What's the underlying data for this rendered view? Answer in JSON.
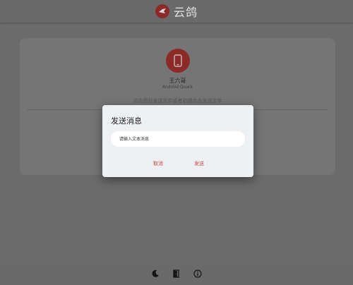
{
  "header": {
    "title": "云鸽",
    "logo_icon": "pigeon-logo-icon"
  },
  "device": {
    "icon": "smartphone-icon",
    "name": "王六哥",
    "subtitle": "Android Quark",
    "hint": "点击图标发送文件或者右键点击发送文字"
  },
  "dialog": {
    "title": "发送消息",
    "input_value": "",
    "input_placeholder": "请输入文本消息",
    "cancel_label": "取消",
    "send_label": "发送"
  },
  "bottom_bar": {
    "icons": [
      "moon-icon",
      "door-icon",
      "info-icon"
    ]
  },
  "colors": {
    "accent": "#c84940",
    "logo_red": "#8c2a28",
    "overlay": "#6b6b6b",
    "dialog_bg": "#eef0f4"
  }
}
